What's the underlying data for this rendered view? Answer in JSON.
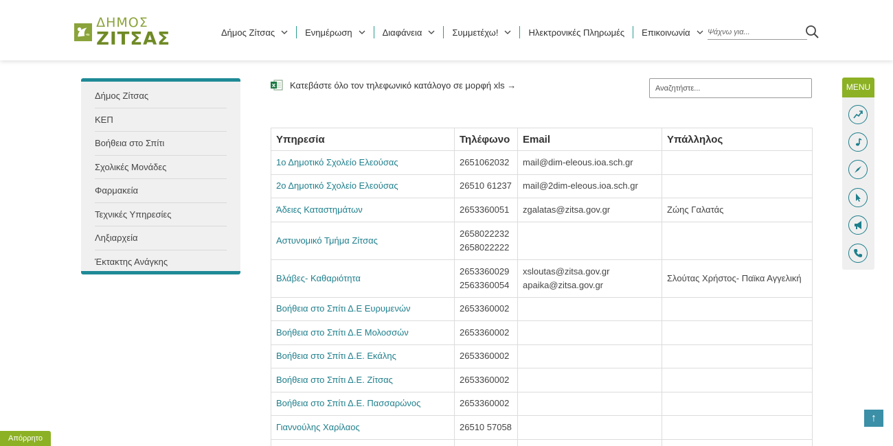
{
  "header": {
    "logo_line1": "ΔΗΜΟΣ",
    "logo_line2": "ΖΙΤΣΑΣ",
    "nav": [
      {
        "label": "Δήμος Ζίτσας",
        "dropdown": true
      },
      {
        "label": "Ενημέρωση",
        "dropdown": true
      },
      {
        "label": "Διαφάνεια",
        "dropdown": true
      },
      {
        "label": "Συμμετέχω!",
        "dropdown": true
      },
      {
        "label": "Ηλεκτρονικές Πληρωμές",
        "dropdown": false
      },
      {
        "label": "Επικοινωνία",
        "dropdown": true
      }
    ],
    "search_placeholder": "Ψάχνω για..."
  },
  "sidebar": {
    "items": [
      {
        "label": "Δήμος Ζίτσας"
      },
      {
        "label": "ΚΕΠ"
      },
      {
        "label": "Βοήθεια στο Σπίτι"
      },
      {
        "label": "Σχολικές Μονάδες"
      },
      {
        "label": "Φαρμακεία"
      },
      {
        "label": "Τεχνικές Υπηρεσίες"
      },
      {
        "label": "Ληξιαρχεία"
      },
      {
        "label": "Έκτακτης Ανάγκης"
      }
    ]
  },
  "main": {
    "download_text": "Κατεβάστε όλο τον τηλεφωνικό κατάλογο σε μορφή xls →",
    "table_search_placeholder": "Αναζητήστε...",
    "table": {
      "headers": [
        "Υπηρεσία",
        "Τηλέφωνο",
        "Email",
        "Υπάλληλος"
      ],
      "rows": [
        {
          "service": "1ο Δημοτικό Σχολείο Ελεούσας",
          "phones": [
            "2651062032"
          ],
          "emails": [
            "mail@dim-eleous.ioa.sch.gr"
          ],
          "employee": ""
        },
        {
          "service": "2ο Δημοτικό Σχολείο Ελεούσας",
          "phones": [
            "26510 61237"
          ],
          "emails": [
            "mail@2dim-eleous.ioa.sch.gr"
          ],
          "employee": ""
        },
        {
          "service": "Άδειες Καταστημάτων",
          "phones": [
            "2653360051"
          ],
          "emails": [
            "zgalatas@zitsa.gov.gr"
          ],
          "employee": "Ζώης Γαλατάς"
        },
        {
          "service": "Αστυνομικό Τμήμα Ζίτσας",
          "phones": [
            "2658022232",
            "2658022222"
          ],
          "emails": [],
          "employee": ""
        },
        {
          "service": "Βλάβες- Καθαριότητα",
          "phones": [
            "2653360029",
            "2563360054"
          ],
          "emails": [
            "xsloutas@zitsa.gov.gr",
            "apaika@zitsa.gov.gr"
          ],
          "employee": "Σλούτας Χρήστος- Παϊκα Αγγελική"
        },
        {
          "service": "Βοήθεια στο Σπίτι Δ.Ε Ευρυμενών",
          "phones": [
            "2653360002"
          ],
          "emails": [],
          "employee": ""
        },
        {
          "service": "Βοήθεια στο Σπίτι Δ.Ε Μολοσσών",
          "phones": [
            "2653360002"
          ],
          "emails": [],
          "employee": ""
        },
        {
          "service": "Βοήθεια στο Σπίτι Δ.Ε. Εκάλης",
          "phones": [
            "2653360002"
          ],
          "emails": [],
          "employee": ""
        },
        {
          "service": "Βοήθεια στο Σπίτι Δ.Ε. Ζίτσας",
          "phones": [
            "2653360002"
          ],
          "emails": [],
          "employee": ""
        },
        {
          "service": "Βοήθεια στο Σπίτι Δ.Ε. Πασσαρώνος",
          "phones": [
            "2653360002"
          ],
          "emails": [],
          "employee": ""
        },
        {
          "service": "Γιαννούλης Χαρίλαος",
          "phones": [
            "26510 57058"
          ],
          "emails": [],
          "employee": ""
        },
        {
          "service": "",
          "phones": [],
          "emails": [],
          "employee": ""
        }
      ]
    }
  },
  "float_menu": {
    "label": "MENU",
    "icons": [
      "chart-trend-icon",
      "music-note-icon",
      "compass-icon",
      "pointer-icon",
      "megaphone-icon",
      "phone-icon"
    ]
  },
  "back_to_top": "↑",
  "privacy_label": "Απόρρητο",
  "colors": {
    "accent": "#1e8a96",
    "brand_green": "#8cb124",
    "link": "#1f7f8c"
  }
}
